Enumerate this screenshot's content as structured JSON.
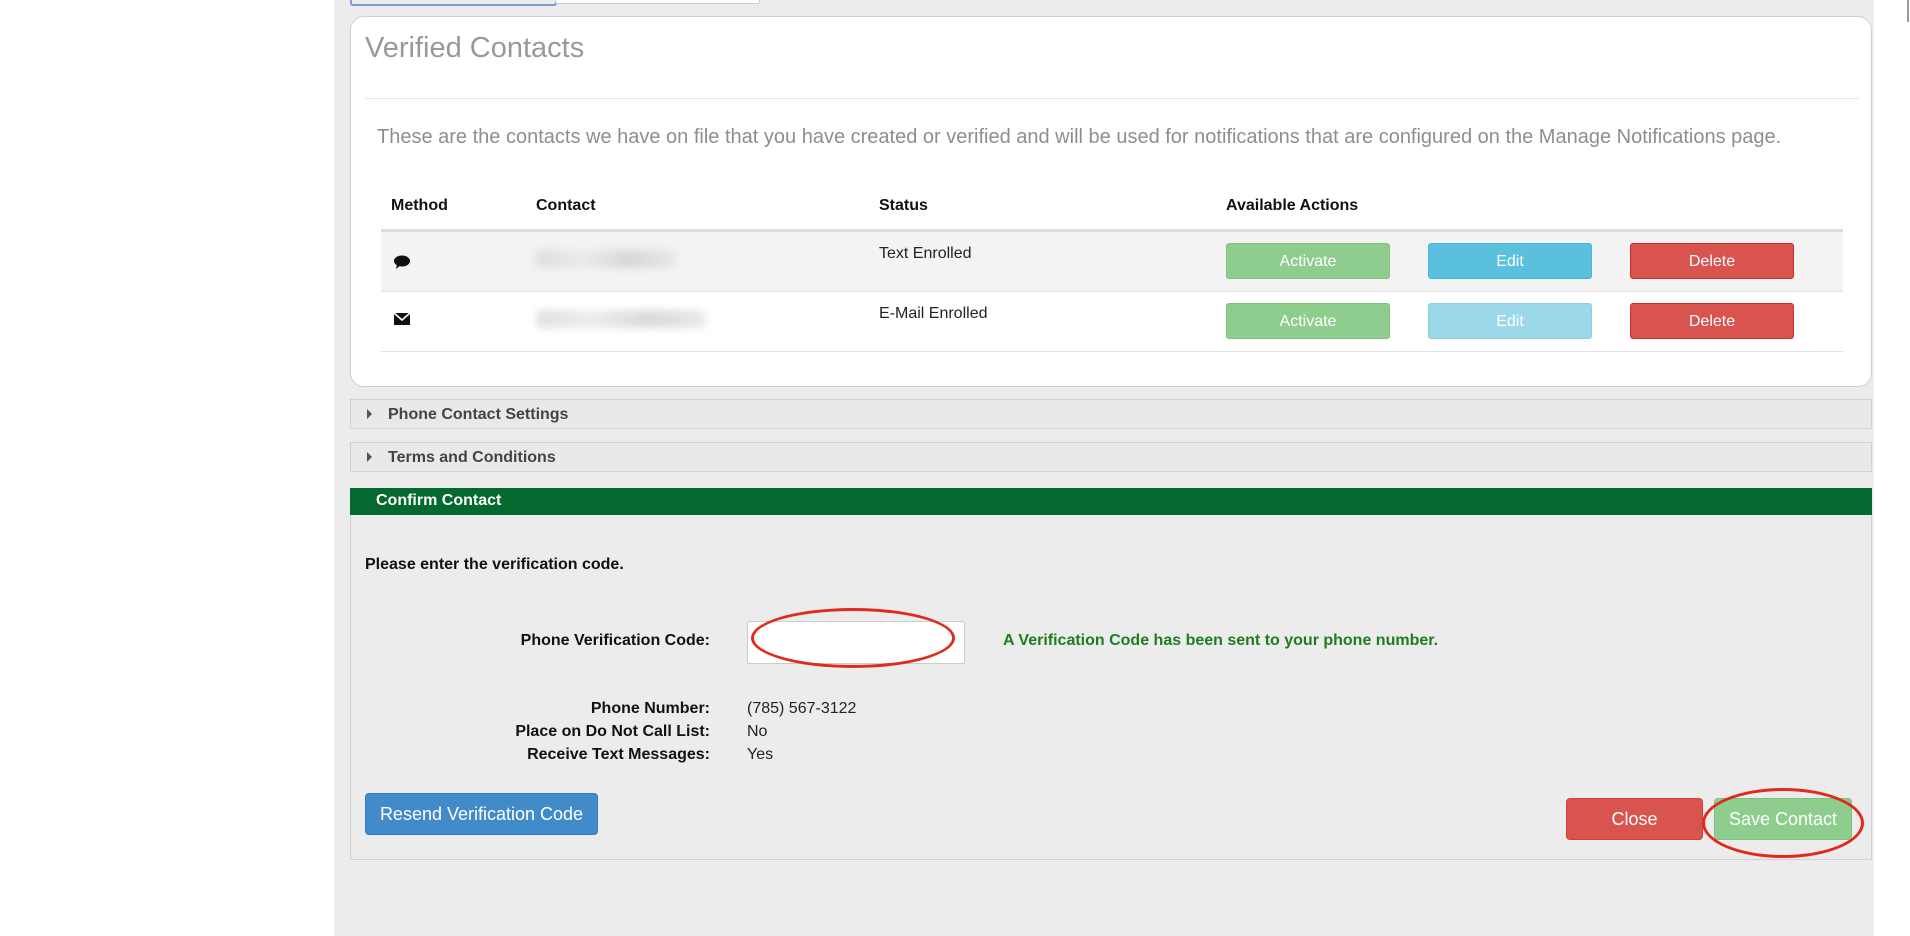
{
  "panel": {
    "title": "Verified Contacts",
    "description": "These are the contacts we have on file that you have created or verified and will be used for notifications that are configured on the Manage Notifications page."
  },
  "table": {
    "headers": {
      "method": "Method",
      "contact": "Contact",
      "status": "Status",
      "actions": "Available Actions"
    },
    "rows": [
      {
        "method_icon": "comment-icon",
        "contact": "",
        "status": "Text Enrolled",
        "activate": "Activate",
        "edit": "Edit",
        "delete": "Delete",
        "edit_disabled": false
      },
      {
        "method_icon": "envelope-icon",
        "contact": "",
        "status": "E-Mail Enrolled",
        "activate": "Activate",
        "edit": "Edit",
        "delete": "Delete",
        "edit_disabled": true
      }
    ]
  },
  "accordions": {
    "phone_settings": "Phone Contact Settings",
    "terms": "Terms and Conditions"
  },
  "confirm": {
    "title": "Confirm Contact",
    "prompt": "Please enter the verification code.",
    "code_label": "Phone Verification Code:",
    "code_value": "",
    "sent_message": "A Verification Code has been sent to your phone number.",
    "phone_label": "Phone Number:",
    "phone_value": "(785) 567-3122",
    "dnc_label": "Place on Do Not Call List:",
    "dnc_value": "No",
    "sms_label": "Receive Text Messages:",
    "sms_value": "Yes",
    "resend_label": "Resend Verification Code",
    "close_label": "Close",
    "save_label": "Save Contact"
  },
  "colors": {
    "confirm_header": "#04692f",
    "primary": "#428bca",
    "danger": "#d9534f",
    "success_light": "#8ecd8e",
    "info": "#5bc0de",
    "annotation": "#e02a1a"
  }
}
